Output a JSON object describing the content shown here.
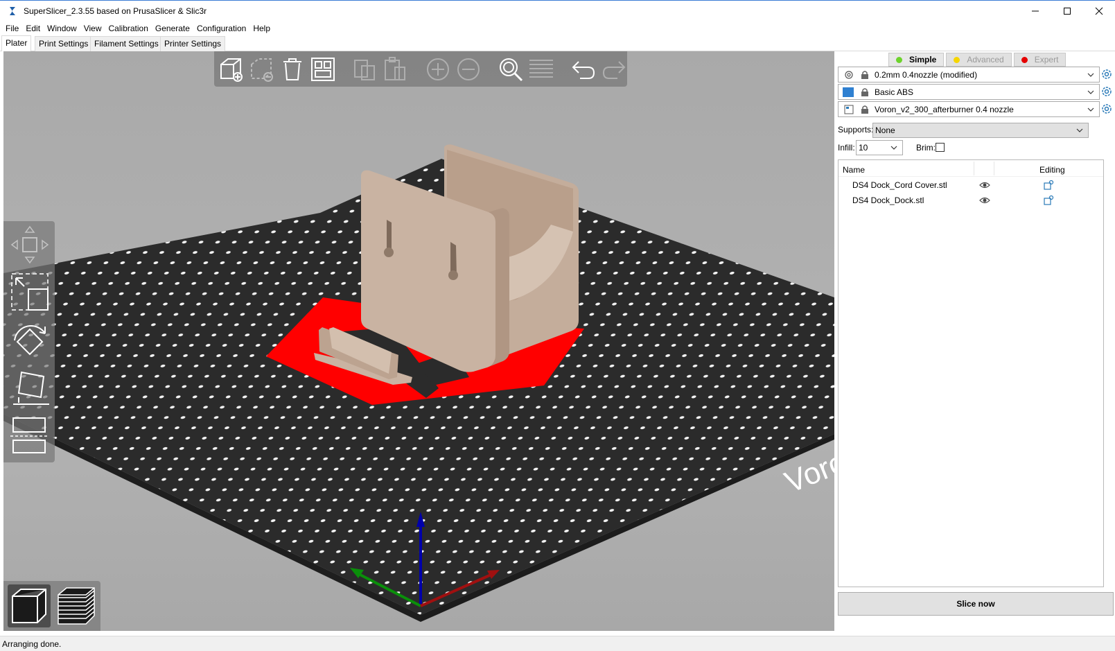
{
  "window": {
    "title": "SuperSlicer_2.3.55 based on PrusaSlicer & Slic3r"
  },
  "menu": [
    "File",
    "Edit",
    "Window",
    "View",
    "Calibration",
    "Generate",
    "Configuration",
    "Help"
  ],
  "tabs": [
    "Plater",
    "Print Settings",
    "Filament Settings",
    "Printer Settings"
  ],
  "active_tab": "Plater",
  "mode": {
    "simple": "Simple",
    "advanced": "Advanced",
    "expert": "Expert",
    "active": "Simple",
    "colors": {
      "simple": "#6dd32c",
      "advanced": "#f6d600",
      "expert": "#e50000"
    }
  },
  "presets": {
    "print": "0.2mm 0.4nozzle (modified)",
    "filament": "Basic ABS",
    "filament_color": "#2f80d1",
    "printer": "Voron_v2_300_afterburner 0.4 nozzle"
  },
  "quick_settings": {
    "supports_label": "Supports:",
    "supports_value": "None",
    "infill_label": "Infill:",
    "infill_value": "10",
    "brim_label": "Brim:",
    "brim_checked": false
  },
  "object_list": {
    "header_name": "Name",
    "header_editing": "Editing",
    "objects": [
      {
        "name": "DS4 Dock_Cord Cover.stl"
      },
      {
        "name": "DS4 Dock_Dock.stl"
      }
    ]
  },
  "slice_button": "Slice now",
  "viewport": {
    "bed_text": "Voron",
    "bed_color": "#2b2b2b",
    "logo_color": "#ff0000",
    "model_color": "#c9b3a2"
  },
  "status": "Arranging done.",
  "icons": {
    "app": "superslicer-logo-icon",
    "toolbar": [
      "add-icon",
      "delete-icon",
      "delete-all-icon",
      "arrange-icon",
      "copy-icon",
      "paste-icon",
      "add-instance-icon",
      "remove-instance-icon",
      "search-icon",
      "layers-editing-icon",
      "undo-icon",
      "redo-icon"
    ]
  }
}
